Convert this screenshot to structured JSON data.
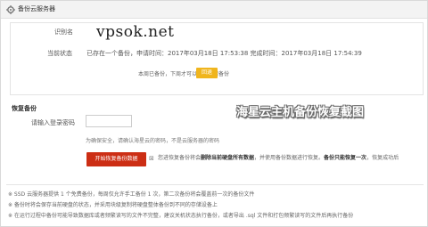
{
  "header": {
    "title": "备份云服务器",
    "icon": "gear-icon"
  },
  "identity": {
    "label": "识别名",
    "value": "vpsok.net"
  },
  "status": {
    "label": "当前状态",
    "value": "已存在一个备份，申请时间：2017年03月18日 17:53:38 完成时间：2017年03月18日 17:54:39"
  },
  "weekly": {
    "note": "本周已备份，下周才可以继续申请备份",
    "button_label": "回退",
    "button_color": "#f0b51d"
  },
  "restore": {
    "heading": "恢复备份",
    "password_label": "请输入登录密码",
    "password_value": "",
    "password_hint": "为确保安全，请确认海星云的密码，不是云服务器的密码",
    "start_button": "开始恢复备份数据",
    "start_button_color": "#cc2e14",
    "warning_prefix": "您进恢复备份将会",
    "warning_bold1": "删除当前硬盘所有数据",
    "warning_mid": "，并使用备份数据进行恢复。",
    "warning_bold2": "备份只能恢复一次",
    "warning_suffix": "，恢复成功后"
  },
  "watermark": {
    "text": "海星云主机备份恢复截图"
  },
  "notes": [
    "※ SSD 云服务器提供 1 个免费备份，每周仅允许手工备份 1 次，第二次备份将会覆盖前一次的备份文件",
    "※ 备份时将会保存当前硬盘的状态，并采用块级复制将硬盘整体备份到不同的存储设备上",
    "※ 在运行过程中备份可能导致数据库或者频繁读写的文件不完整，建议关机状态执行备份，或者导出 .sql 文件和打包频繁读写的文件后再执行备份"
  ]
}
